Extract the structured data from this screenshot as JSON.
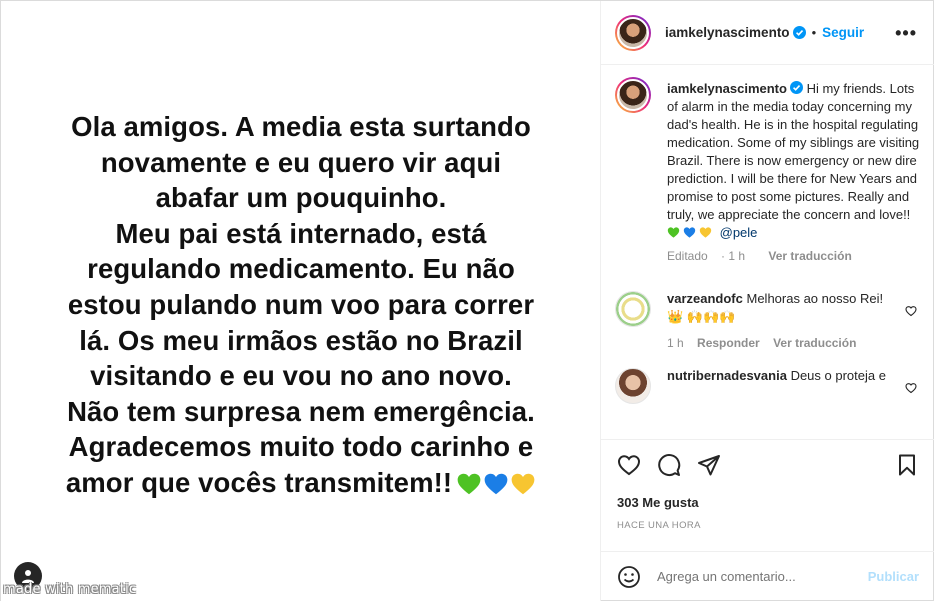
{
  "media": {
    "lines": [
      "Ola amigos. A media esta surtando",
      "novamente e eu quero vir aqui",
      "abafar um pouquinho.",
      "Meu pai está internado, está",
      "regulando medicamento. Eu não",
      "estou pulando num voo para correr",
      "lá. Os meu irmãos estão no Brazil",
      "visitando e eu vou no ano novo.",
      "Não tem surpresa nem emergência.",
      "Agradecemos muito todo carinho e",
      "amor que vocês transmitem!!"
    ],
    "watermark": "made with mematic"
  },
  "header": {
    "username": "iamkelynascimento",
    "separator": "•",
    "follow_label": "Seguir",
    "more_label": "•••"
  },
  "caption": {
    "username": "iamkelynascimento",
    "text": "Hi my friends. Lots of alarm in the media today concerning my dad's health. He is in the hospital regulating medication. Some of my siblings are visiting Brazil. There is now emergency or new dire prediction. I will be there for New Years and promise to post some pictures. Really and truly, we appreciate the concern and love!!",
    "mention": "@pele",
    "edited": "Editado",
    "time": "1 h",
    "translate": "Ver traducción"
  },
  "comments": [
    {
      "username": "varzeandofc",
      "text": "Melhoras ao nosso Rei!",
      "emoji": "👑 🙌🙌🙌",
      "time": "1 h",
      "reply": "Responder",
      "translate": "Ver traducción"
    },
    {
      "username": "nutribernadesvania",
      "text": "Deus o proteja e"
    }
  ],
  "actions": {
    "likes": "303 Me gusta",
    "timestamp": "HACE UNA HORA",
    "comment_placeholder": "Agrega un comentario...",
    "publish_label": "Publicar"
  },
  "colors": {
    "accent": "#0095f6",
    "publish_disabled": "#b2dffc",
    "meta": "#8e8e8e"
  }
}
